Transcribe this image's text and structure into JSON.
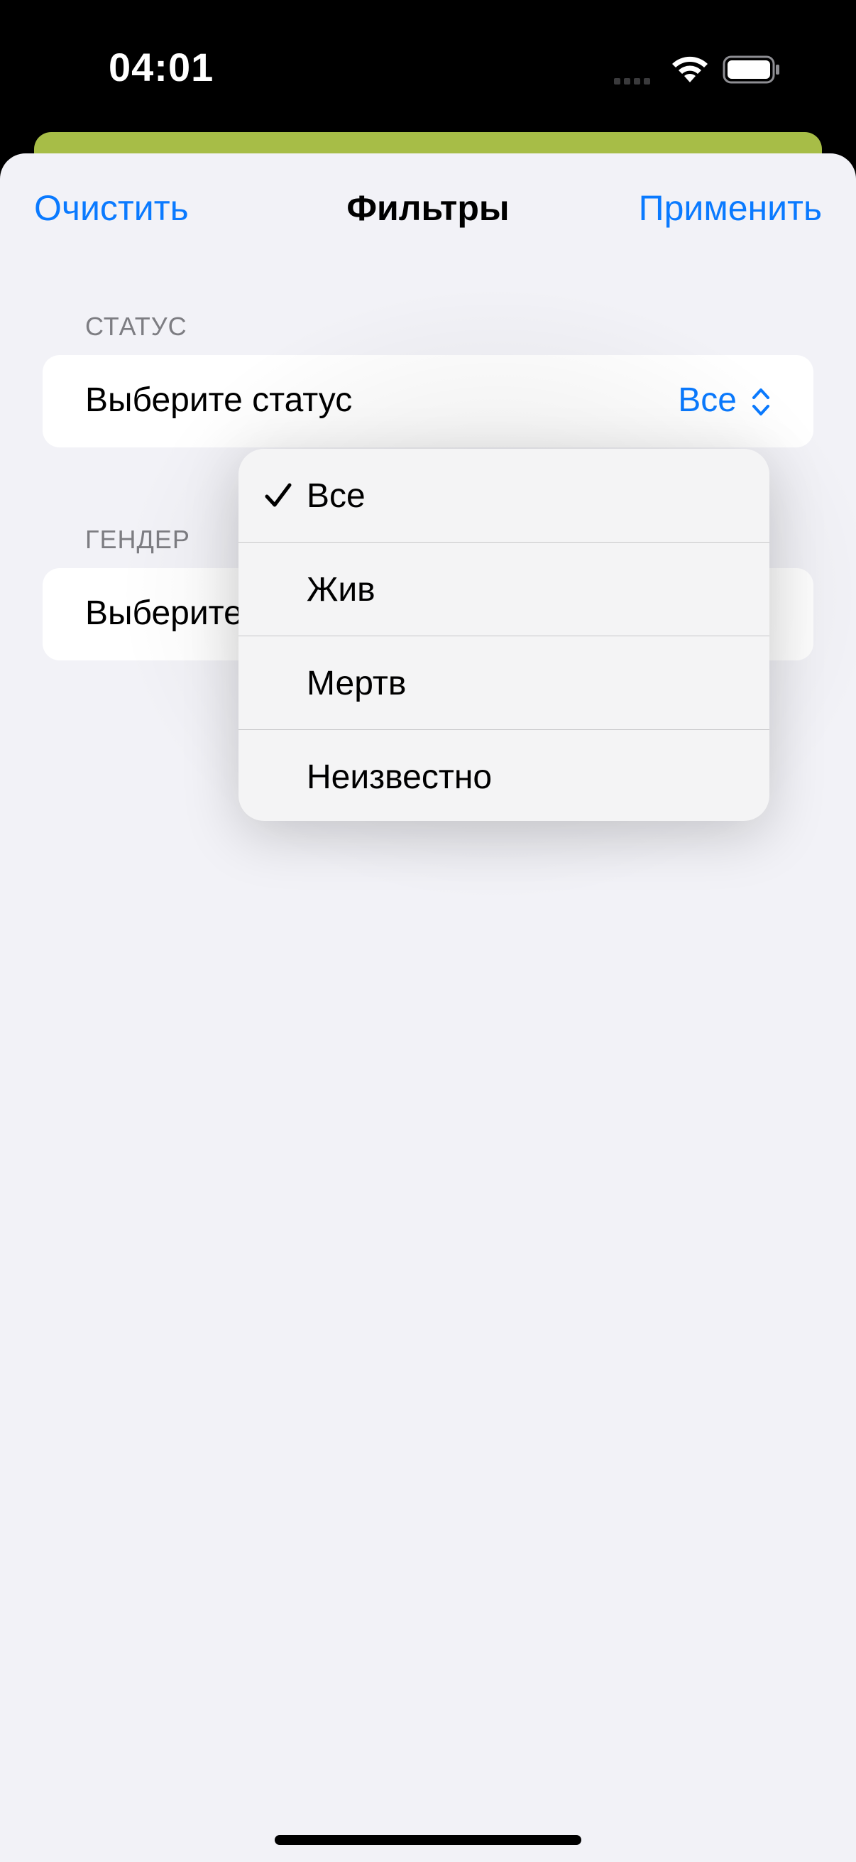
{
  "status_bar": {
    "time": "04:01"
  },
  "nav": {
    "clear_label": "Очистить",
    "title": "Фильтры",
    "apply_label": "Применить"
  },
  "status_section": {
    "header": "СТАТУС",
    "field_label": "Выберите статус",
    "selected_value": "Все"
  },
  "gender_section": {
    "header": "ГЕНДЕР",
    "field_label": "Выберите"
  },
  "status_menu": {
    "items": [
      {
        "label": "Все",
        "checked": true
      },
      {
        "label": "Жив",
        "checked": false
      },
      {
        "label": "Мертв",
        "checked": false
      },
      {
        "label": "Неизвестно",
        "checked": false
      }
    ]
  },
  "colors": {
    "accent": "#0a7aff",
    "sheet_background": "#f2f2f7",
    "backdrop_strip": "#a7bd47"
  }
}
